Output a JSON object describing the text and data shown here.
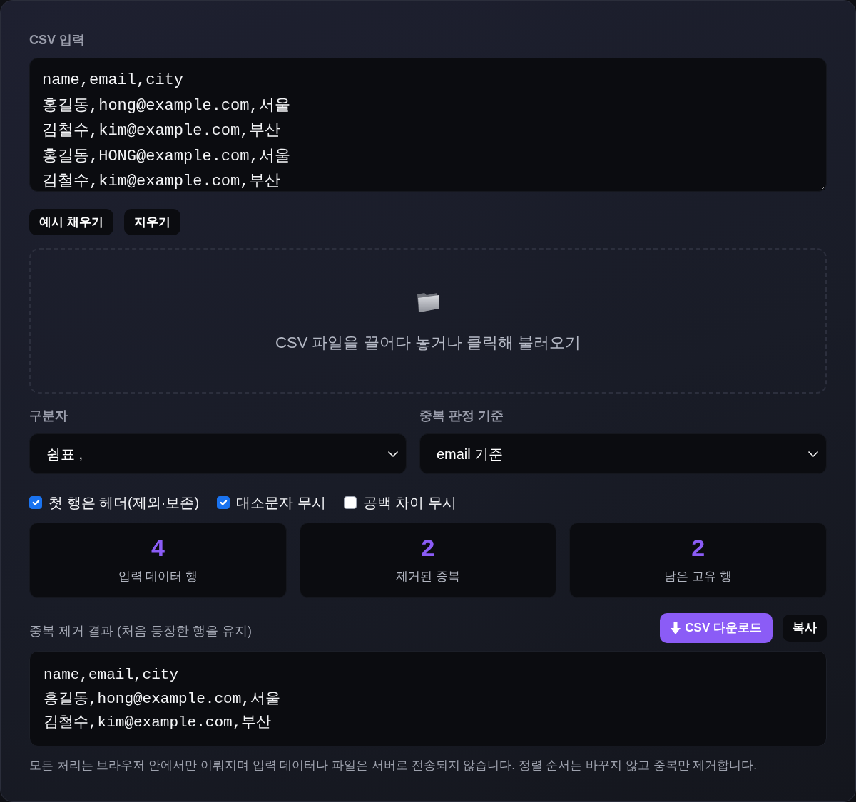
{
  "input": {
    "label": "CSV 입력",
    "lines": [
      "name,email,city",
      "홍길동,hong@example.com,서울",
      "김철수,kim@example.com,부산",
      "홍길동,HONG@example.com,서울",
      "김철수,kim@example.com,부산"
    ]
  },
  "buttons": [
    "예시 채우기",
    "지우기"
  ],
  "dropzone": {
    "text": "CSV 파일을 끌어다 놓거나 클릭해 불러오기"
  },
  "selects": [
    {
      "label": "구분자",
      "value": "쉼표 ,"
    },
    {
      "label": "중복 판정 기준",
      "value": "email 기준"
    }
  ],
  "options": [
    {
      "label": "첫 행은 헤더(제외·보존)",
      "checked": true
    },
    {
      "label": "대소문자 무시",
      "checked": true
    },
    {
      "label": "공백 차이 무시",
      "checked": false
    }
  ],
  "stats": [
    {
      "value": "4",
      "label": "입력 데이터 행"
    },
    {
      "value": "2",
      "label": "제거된 중복"
    },
    {
      "value": "2",
      "label": "남은 고유 행"
    }
  ],
  "result": {
    "label": "중복 제거 결과 (처음 등장한 행을 유지)",
    "actions": [
      {
        "kind": "primary",
        "label": "CSV 다운로드"
      },
      {
        "kind": "secondary",
        "label": "복사"
      }
    ],
    "lines": [
      "name,email,city",
      "홍길동,hong@example.com,서울",
      "김철수,kim@example.com,부산"
    ]
  },
  "note": "모든 처리는 브라우저 안에서만 이뤄지며 입력 데이터나 파일은 서버로 전송되지 않습니다. 정렬 순서는 바꾸지 않고 중복만 제거합니다."
}
